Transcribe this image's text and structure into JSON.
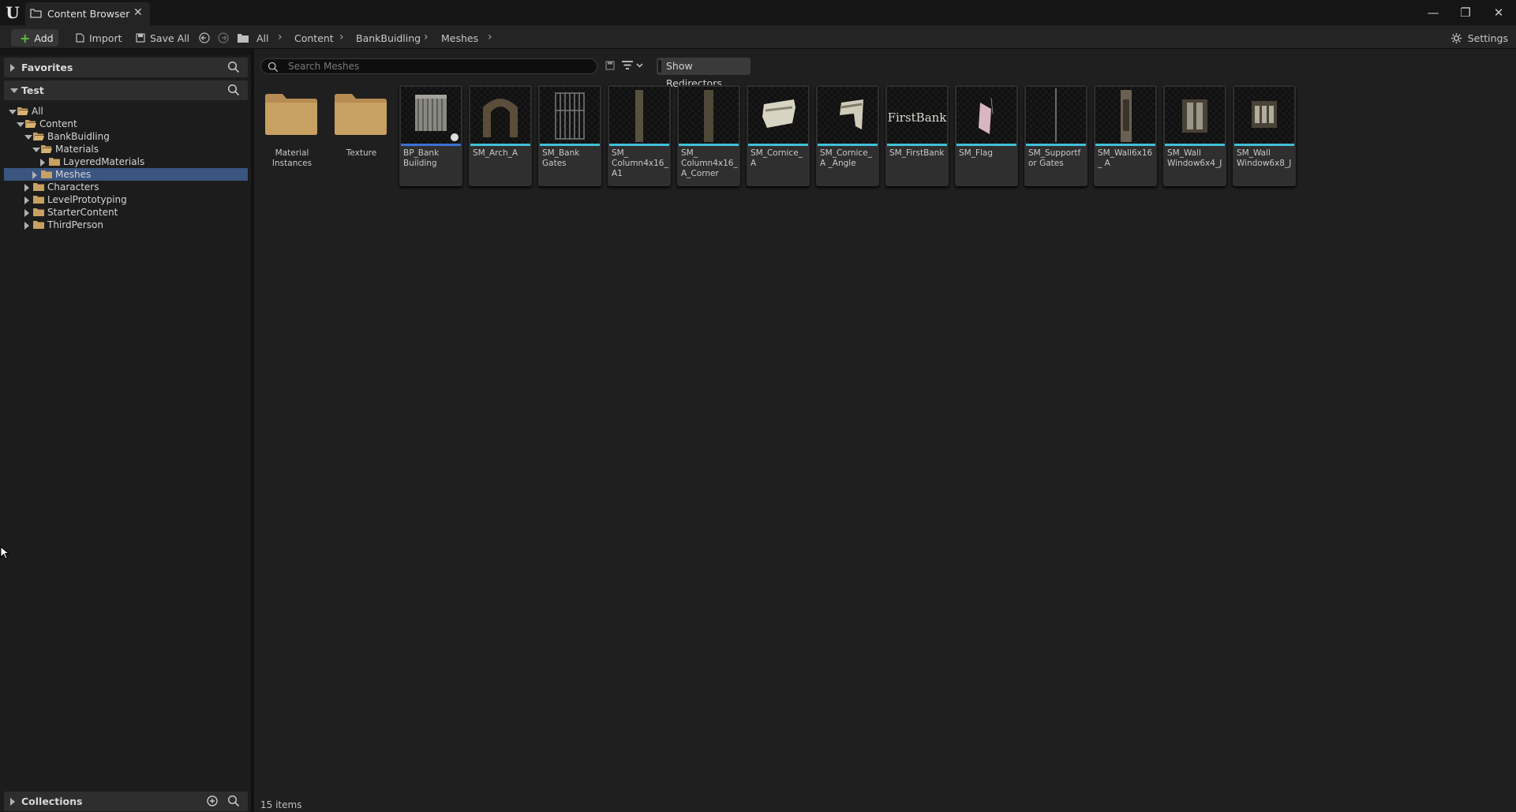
{
  "window": {
    "tab_title": "Content Browser",
    "tab_close": "✕",
    "minimize": "—",
    "restore": "❐",
    "close": "✕"
  },
  "toolbar": {
    "add_label": "Add",
    "import_label": "Import",
    "save_all_label": "Save All",
    "settings_label": "Settings",
    "breadcrumb": [
      "All",
      "Content",
      "BankBuidling",
      "Meshes"
    ]
  },
  "left_panel": {
    "favorites_label": "Favorites",
    "test_label": "Test",
    "collections_label": "Collections",
    "tree": [
      {
        "label": "All",
        "depth": 0,
        "expanded": true
      },
      {
        "label": "Content",
        "depth": 1,
        "expanded": true
      },
      {
        "label": "BankBuidling",
        "depth": 2,
        "expanded": true
      },
      {
        "label": "Materials",
        "depth": 3,
        "expanded": true
      },
      {
        "label": "LayeredMaterials",
        "depth": 4,
        "expanded": false
      },
      {
        "label": "Meshes",
        "depth": 3,
        "expanded": false,
        "selected": true
      },
      {
        "label": "Characters",
        "depth": 2,
        "expanded": false
      },
      {
        "label": "LevelPrototyping",
        "depth": 2,
        "expanded": false
      },
      {
        "label": "StarterContent",
        "depth": 2,
        "expanded": false
      },
      {
        "label": "ThirdPerson",
        "depth": 2,
        "expanded": false
      }
    ]
  },
  "content": {
    "search_placeholder": "Search Meshes",
    "show_redirectors_label": "Show Redirectors",
    "item_count": "15 items",
    "assets": [
      {
        "name": "Material Instances",
        "kind": "folder"
      },
      {
        "name": "Texture",
        "kind": "folder"
      },
      {
        "name": "BP_Bank Building",
        "kind": "blueprint"
      },
      {
        "name": "SM_Arch_A",
        "kind": "mesh"
      },
      {
        "name": "SM_Bank Gates",
        "kind": "mesh"
      },
      {
        "name": "SM_ Column4x16_ A1",
        "kind": "mesh"
      },
      {
        "name": "SM_ Column4x16_ A_Corner",
        "kind": "mesh"
      },
      {
        "name": "SM_Cornice_A",
        "kind": "mesh"
      },
      {
        "name": "SM_Cornice_A _Angle",
        "kind": "mesh"
      },
      {
        "name": "SM_FirstBank",
        "kind": "mesh",
        "thumb_text": "FirstBank"
      },
      {
        "name": "SM_Flag",
        "kind": "mesh"
      },
      {
        "name": "SM_Supportfor Gates",
        "kind": "mesh"
      },
      {
        "name": "SM_Wall6x16_ A",
        "kind": "mesh"
      },
      {
        "name": "SM_Wall Window6x4_J",
        "kind": "mesh"
      },
      {
        "name": "SM_Wall Window6x8_J",
        "kind": "mesh"
      }
    ]
  },
  "colors": {
    "mesh_bar": "#41c0d8",
    "blueprint_bar": "#3d6fd6",
    "folder": "#c8a062",
    "selection": "#3a5580",
    "add_plus": "#5cc040"
  }
}
